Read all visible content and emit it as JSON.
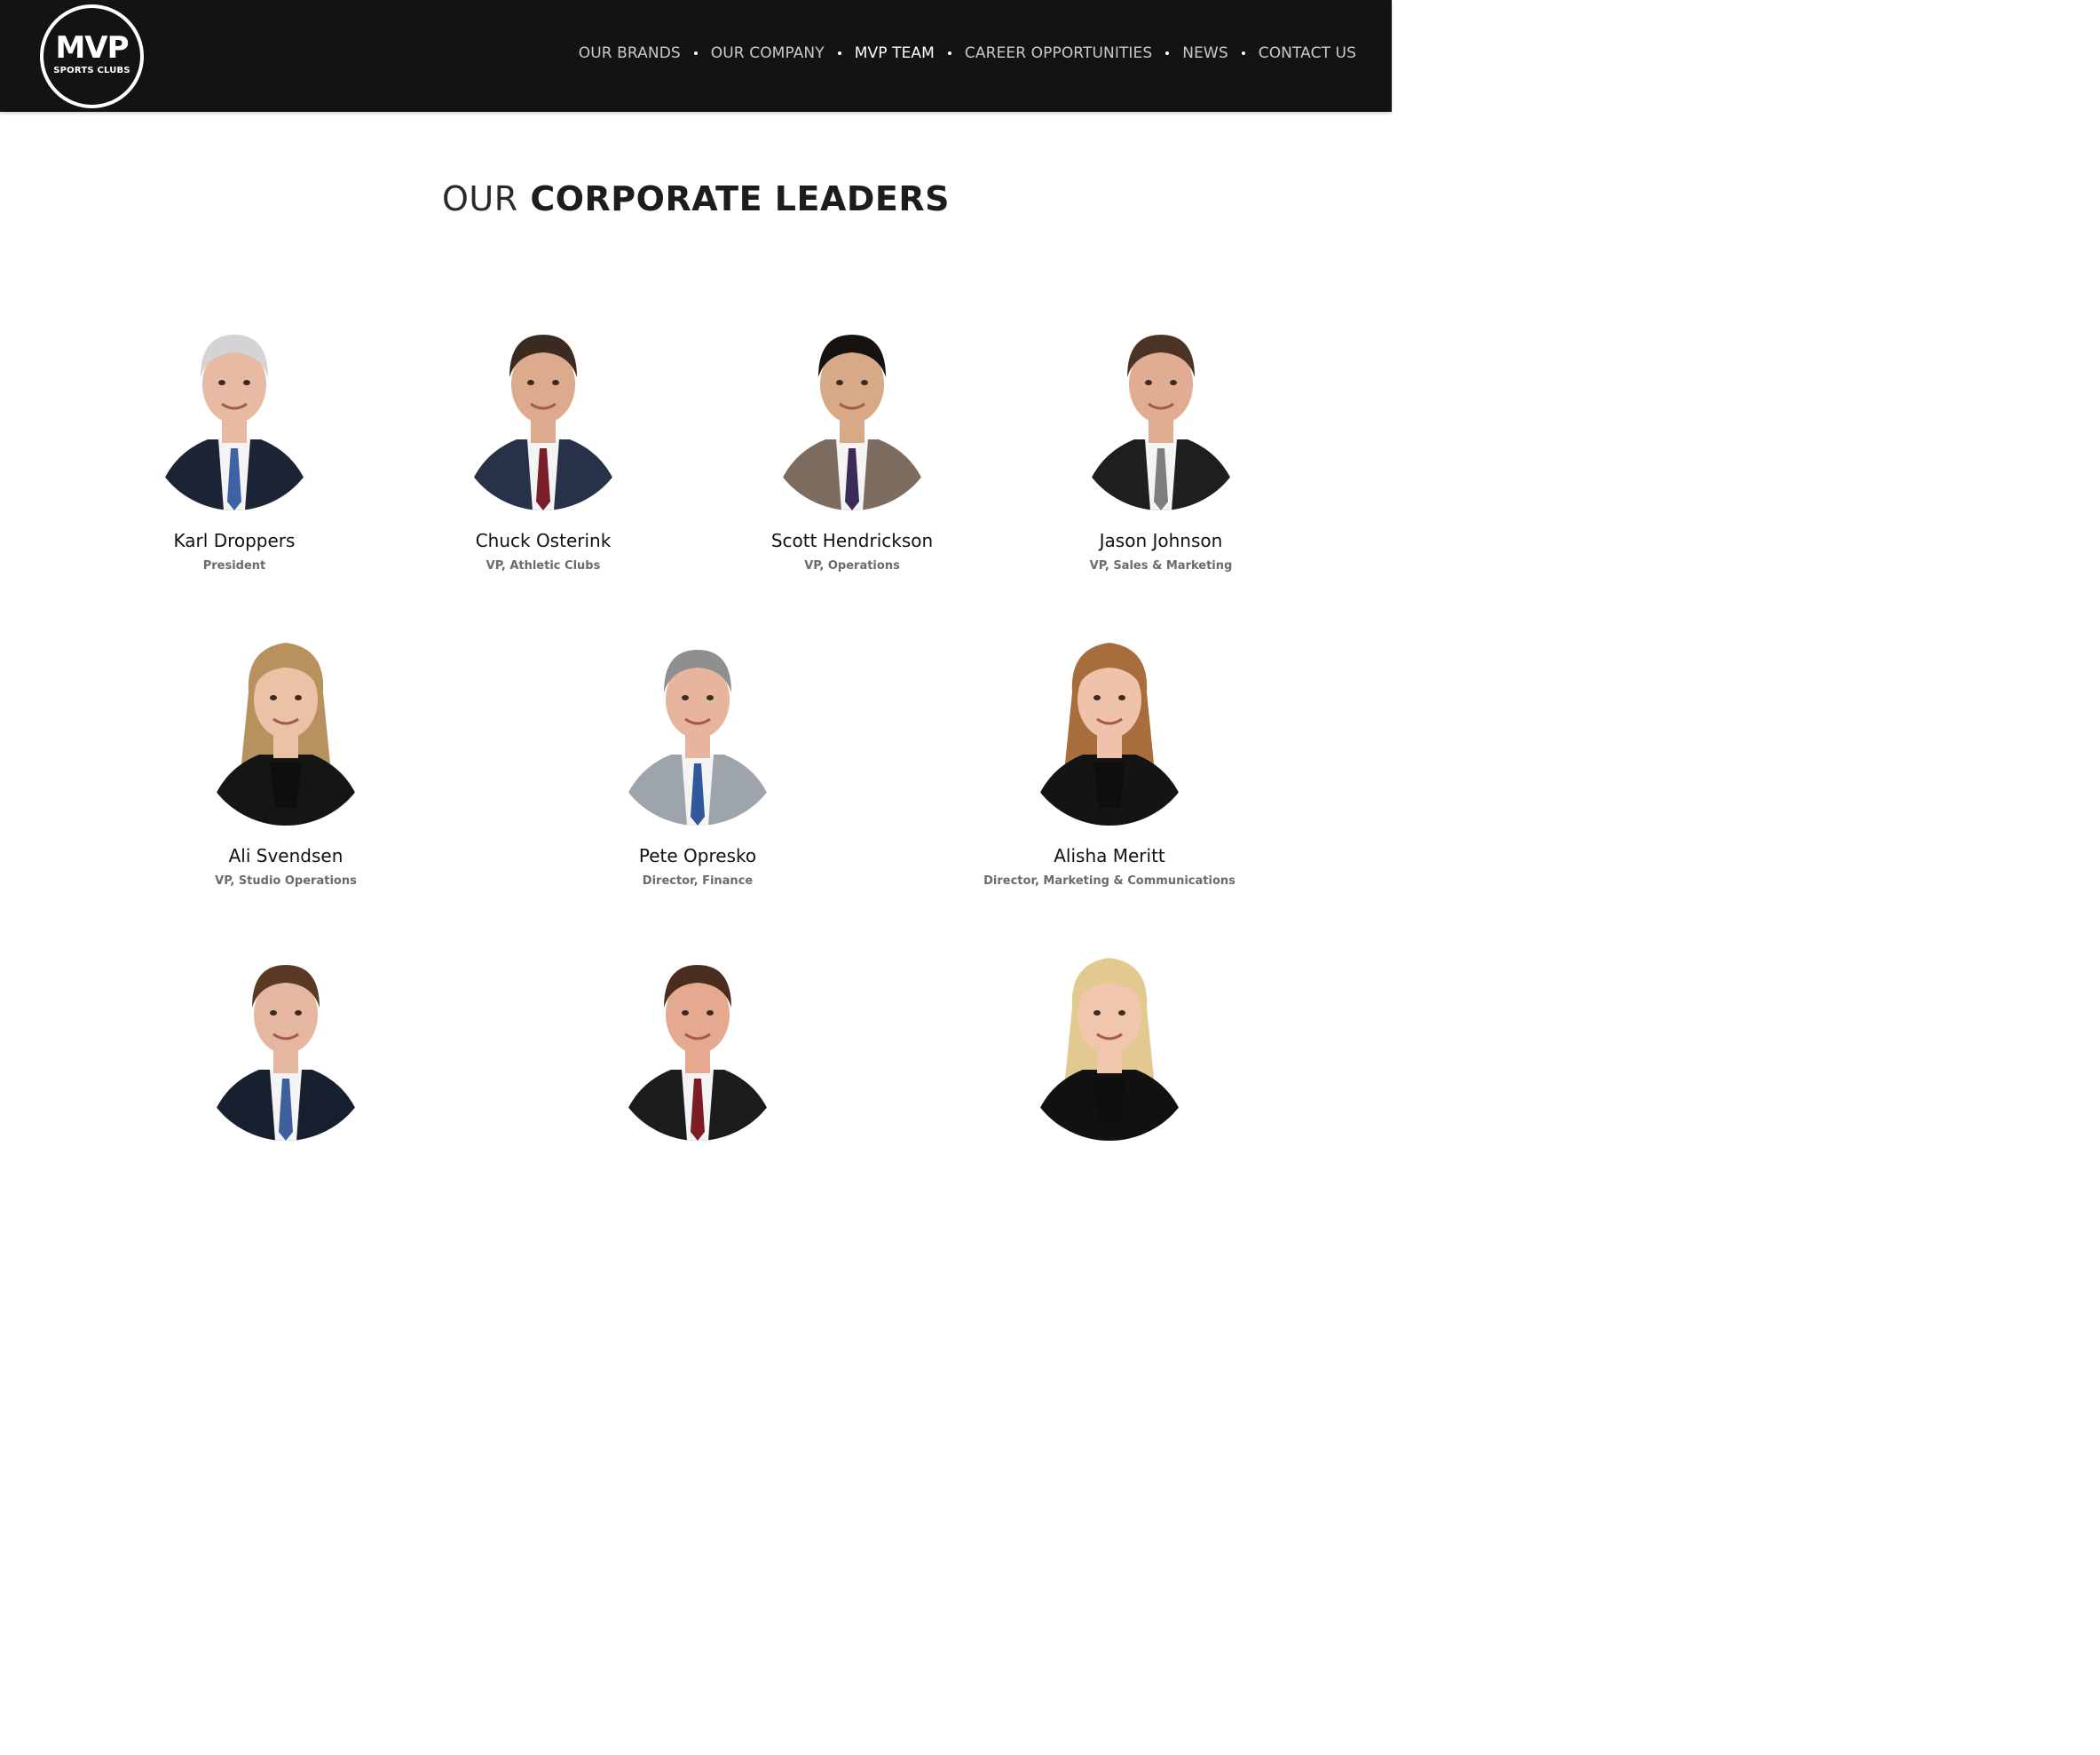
{
  "header": {
    "logo": {
      "main": "MVP",
      "sub": "SPORTS CLUBS"
    },
    "nav": [
      {
        "label": "OUR BRANDS",
        "active": false
      },
      {
        "label": "OUR COMPANY",
        "active": false
      },
      {
        "label": "MVP TEAM",
        "active": true
      },
      {
        "label": "CAREER OPPORTUNITIES",
        "active": false
      },
      {
        "label": "NEWS",
        "active": false
      },
      {
        "label": "CONTACT US",
        "active": false
      }
    ]
  },
  "section": {
    "title_light": "OUR",
    "title_bold": "CORPORATE LEADERS"
  },
  "team": [
    {
      "name": "Karl Droppers",
      "role": "President",
      "hair": "#d4d4d4",
      "skin": "#e8b9a3",
      "suit": "#1b2536",
      "tie": "#3f62a3"
    },
    {
      "name": "Chuck Osterink",
      "role": "VP, Athletic Clubs",
      "hair": "#3a2a20",
      "skin": "#dcab8d",
      "suit": "#273249",
      "tie": "#7a1e2a"
    },
    {
      "name": "Scott Hendrickson",
      "role": "VP, Operations",
      "hair": "#16120f",
      "skin": "#d7a987",
      "suit": "#7c6d60",
      "tie": "#3b2b56"
    },
    {
      "name": "Jason Johnson",
      "role": "VP, Sales & Marketing",
      "hair": "#4b3426",
      "skin": "#e0ad92",
      "suit": "#1e1e1e",
      "tie": "#7e7e7e"
    },
    {
      "name": "Ali Svendsen",
      "role": "VP, Studio Operations",
      "hair": "#b8925e",
      "skin": "#ecc2a7",
      "suit": "#151515",
      "tie": ""
    },
    {
      "name": "Pete Opresko",
      "role": "Director, Finance",
      "hair": "#8f8f8f",
      "skin": "#e7b49d",
      "suit": "#9ea4ab",
      "tie": "#30589b"
    },
    {
      "name": "Alisha Meritt",
      "role": "Director, Marketing & Communications",
      "hair": "#a86d3c",
      "skin": "#efc3a9",
      "suit": "#141414",
      "tie": ""
    },
    {
      "name": "",
      "role": "",
      "hair": "#5a3a24",
      "skin": "#e6b7a0",
      "suit": "#17202f",
      "tie": "#3d5f9c"
    },
    {
      "name": "",
      "role": "",
      "hair": "#4a2d1f",
      "skin": "#e4a98f",
      "suit": "#1c1c1c",
      "tie": "#7b1d24"
    },
    {
      "name": "",
      "role": "",
      "hair": "#e2c98f",
      "skin": "#f0c6ad",
      "suit": "#111111",
      "tie": ""
    }
  ]
}
